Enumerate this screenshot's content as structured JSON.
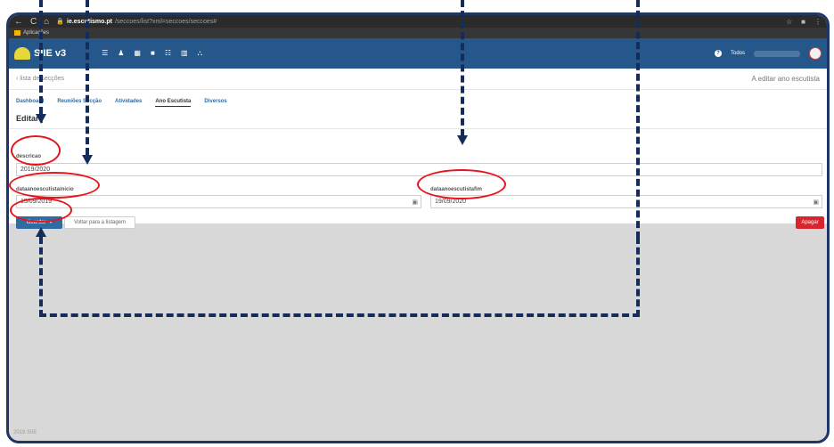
{
  "browser": {
    "url_host": "ie.escutismo.pt",
    "url_path": "/seccoes/list?xml=seccoes/seccoes#",
    "bookmarks_label": "Aplicações"
  },
  "app": {
    "title": "SIIE v3",
    "scope": "Todos"
  },
  "page": {
    "back_link": "‹ lista de secções",
    "mode_label": "A editar ano escutista",
    "tabs": [
      {
        "label": "Dashboard"
      },
      {
        "label": "Reuniões Secção"
      },
      {
        "label": "Atividades"
      },
      {
        "label": "Ano Escutista",
        "active": true
      },
      {
        "label": "Diversos"
      }
    ],
    "edit_title": "Editar |"
  },
  "form": {
    "descricao_label": "descricao",
    "descricao_value": "2019/2020",
    "inicio_label": "dataanoescutistainicio",
    "inicio_value": "15/09/2019",
    "fim_label": "dataanoescutistafim",
    "fim_value": "19/09/2020",
    "save_label": "Guardar",
    "back_label": "Voltar para a listagem",
    "delete_label": "Apagar"
  },
  "footer": {
    "text": "2019 SIIE"
  },
  "colors": {
    "appbar": "#26578a",
    "primary_button": "#2e6da4",
    "danger_button": "#d9232d",
    "annotation_red": "#e8141c",
    "annotation_navy": "#152c5b"
  }
}
